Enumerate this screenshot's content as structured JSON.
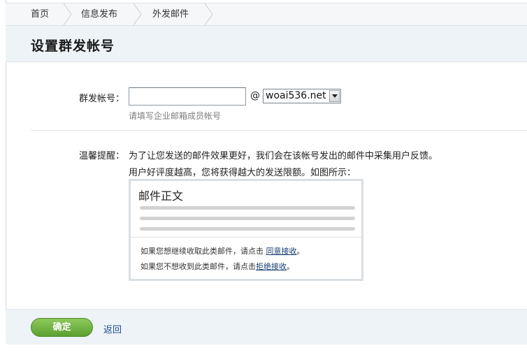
{
  "breadcrumb": {
    "items": [
      {
        "label": "首页"
      },
      {
        "label": "信息发布"
      },
      {
        "label": "外发邮件"
      }
    ]
  },
  "page_title": "设置群发帐号",
  "form": {
    "account_label": "群发帐号：",
    "account_value": "",
    "account_placeholder": "",
    "at_sign": "@",
    "domain_selected": "woai536.net",
    "hint": "请填写企业邮箱成员帐号"
  },
  "tip": {
    "label": "温馨提醒：",
    "line1": "为了让您发送的邮件效果更好，我们会在该帐号发出的邮件中采集用户反馈。",
    "line2": "用户好评度越高，您将获得越大的发送限额。如图所示："
  },
  "preview": {
    "title": "邮件正文",
    "accept_prefix": "如果您想继续收取此类邮件，请点击 ",
    "accept_link": "同意接收",
    "accept_suffix": "。",
    "reject_prefix": "如果您不想收到此类邮件，请点击",
    "reject_link": "拒绝接收",
    "reject_suffix": "。"
  },
  "footer": {
    "confirm_label": "确定",
    "back_label": "返回"
  },
  "colors": {
    "button_green": "#5aa030",
    "link_blue": "#1f4e8c",
    "band_bg": "#eef3f7"
  }
}
